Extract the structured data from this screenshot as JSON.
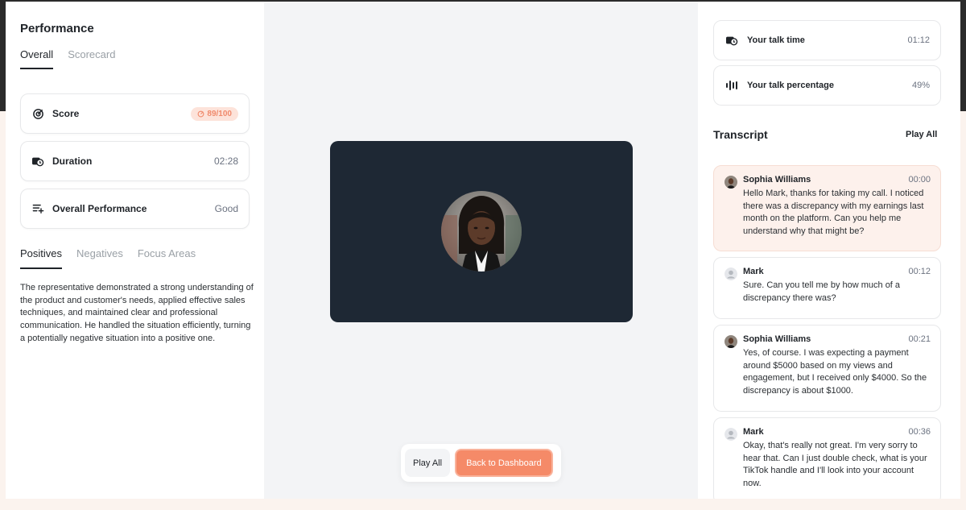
{
  "performance": {
    "title": "Performance",
    "tabs": [
      {
        "label": "Overall"
      },
      {
        "label": "Scorecard"
      }
    ],
    "score": {
      "label": "Score",
      "value": "89/100"
    },
    "duration": {
      "label": "Duration",
      "value": "02:28"
    },
    "overall": {
      "label": "Overall Performance",
      "value": "Good"
    },
    "feedback_tabs": [
      {
        "label": "Positives"
      },
      {
        "label": "Negatives"
      },
      {
        "label": "Focus Areas"
      }
    ],
    "summary": "The representative demonstrated a strong understanding of the product and customer's needs, applied effective sales techniques, and maintained clear and professional communication. He handled the situation efficiently, turning a potentially negative situation into a positive one."
  },
  "controls": {
    "play_all": "Play All",
    "back": "Back to Dashboard"
  },
  "metrics": {
    "talk_time": {
      "label": "Your talk time",
      "value": "01:12"
    },
    "talk_pct": {
      "label": "Your talk percentage",
      "value": "49%"
    }
  },
  "transcript": {
    "title": "Transcript",
    "play_all": "Play All",
    "messages": [
      {
        "name": "Sophia Williams",
        "time": "00:00",
        "text": "Hello Mark, thanks for taking my call. I noticed there was a discrepancy with my earnings last month on the platform. Can you help me understand why that might be?"
      },
      {
        "name": "Mark",
        "time": "00:12",
        "text": "Sure. Can you tell me by how much of a discrepancy there was?"
      },
      {
        "name": "Sophia Williams",
        "time": "00:21",
        "text": "Yes, of course. I was expecting a payment around $5000 based on my views and engagement, but I received only $4000. So the discrepancy is about $1000."
      },
      {
        "name": "Mark",
        "time": "00:36",
        "text": "Okay, that's really not great. I'm very sorry to hear that. Can I just double check, what is your TikTok handle and I'll look into your account now."
      }
    ]
  },
  "colors": {
    "accent": "#f58a68",
    "video_bg": "#1e2834",
    "highlight": "#fdf1ec"
  }
}
